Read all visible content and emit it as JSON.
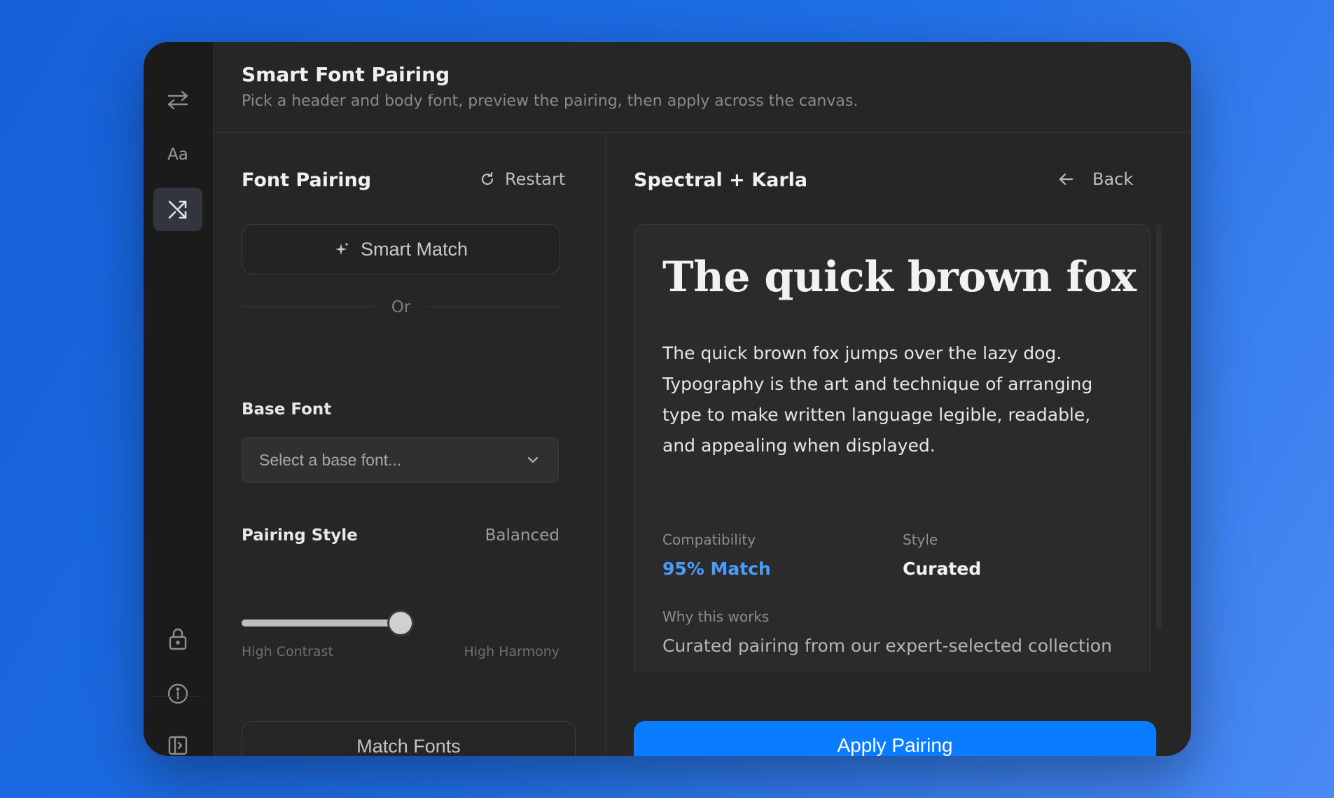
{
  "header": {
    "title": "Smart Font Pairing",
    "subtitle": "Pick a header and body font, preview the pairing, then apply across the canvas."
  },
  "rail": {
    "icons": [
      "swap-arrows-icon",
      "text-aa-icon",
      "shuffle-icon",
      "lock-icon",
      "info-icon",
      "panel-toggle-icon"
    ],
    "aa_label": "Aa",
    "active": "shuffle-icon"
  },
  "left": {
    "title": "Font Pairing",
    "restart_label": "Restart",
    "smart_match_label": "Smart Match",
    "or_label": "Or",
    "base_font_label": "Base Font",
    "base_font_placeholder": "Select a base font...",
    "pairing_style_label": "Pairing Style",
    "pairing_style_value": "Balanced",
    "slider": {
      "min_label": "High Contrast",
      "max_label": "High Harmony",
      "value": 0.5
    },
    "match_button_label": "Match Fonts"
  },
  "right": {
    "title": "Spectral + Karla",
    "back_label": "Back",
    "preview_headline": "The quick brown fox",
    "preview_body": "The quick brown fox jumps over the lazy dog. Typography is the art and technique of arranging type to make written language legible, readable, and appealing when displayed.",
    "compatibility_label": "Compatibility",
    "compatibility_value": "95% Match",
    "style_label": "Style",
    "style_value": "Curated",
    "why_label": "Why this works",
    "why_text": "Curated pairing from our expert-selected collection",
    "apply_label": "Apply Pairing"
  },
  "colors": {
    "accent": "#0a7cff",
    "match_text": "#4a9dff",
    "window_bg": "#262626",
    "rail_bg": "#1b1b1b"
  }
}
